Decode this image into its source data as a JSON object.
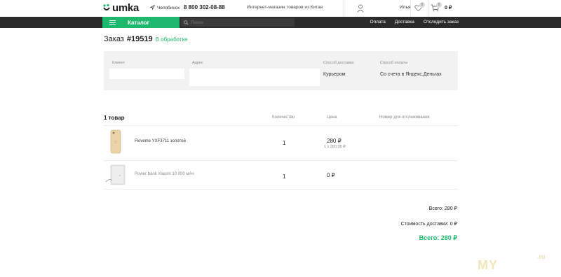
{
  "header": {
    "logo_text": "umka",
    "city": "Челябинск",
    "phone": "8 800 302-08-88",
    "tagline": "Интернет-магазин товаров из Китая",
    "user_name": "Илья",
    "favorites_count": "0",
    "cart_count": "0",
    "cart_total": "0 ₽"
  },
  "nav": {
    "catalog_label": "Каталог",
    "search_placeholder": "Поиск",
    "links": [
      "Оплата",
      "Доставка",
      "Отследить заказ"
    ]
  },
  "order": {
    "title_prefix": "Заказ",
    "number": "#19519",
    "status": "В обработке",
    "client_label": "Клиент",
    "address_label": "Адрес",
    "delivery_label": "Способ доставки",
    "delivery_value": "Курьером",
    "payment_label": "Способ оплаты",
    "payment_value": "Со счета в Яндекс.Деньгах"
  },
  "items_table": {
    "title": "1 товар",
    "col_qty": "Количество",
    "col_price": "Цена",
    "col_tracking": "Номер для отслеживания",
    "rows": [
      {
        "name": "Floveme YXF3711 золотой",
        "qty": "1",
        "price": "280 ₽",
        "sub": "1 x 280.00 ₽"
      },
      {
        "name": "Power bank Xiaomi 10 000 мАч",
        "qty": "1",
        "price": "0 ₽",
        "sub": ""
      }
    ]
  },
  "totals": {
    "total": "Всего: 280 ₽",
    "delivery": "Стоимость доставки: 0 ₽",
    "grand": "Всего: 280 ₽"
  },
  "watermark": {
    "text": "MY",
    "sub": ".ru"
  },
  "colors": {
    "accent": "#1db86b",
    "navbar": "#2b2b2b"
  }
}
